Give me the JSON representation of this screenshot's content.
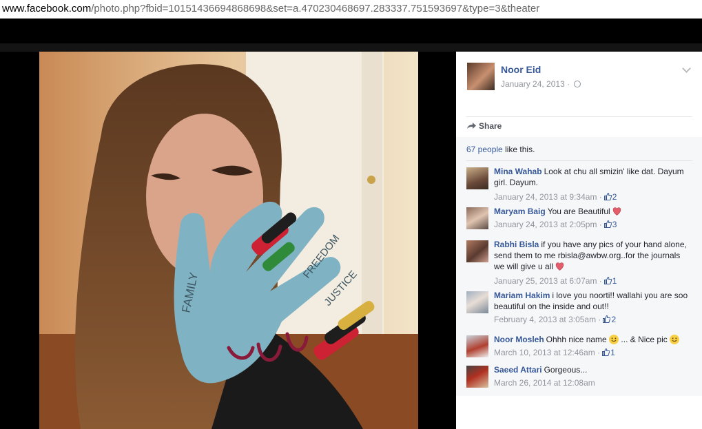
{
  "browser": {
    "url_domain": "www.facebook.com",
    "url_path": "/photo.php?fbid=10151436694868698&set=a.470230468697.283337.751593697&type=3&theater"
  },
  "photo": {
    "hand_words": [
      "FAMILY",
      "FREEDOM",
      "JUSTICE"
    ],
    "colors": {
      "hand": "#7fb3c4",
      "skin": "#d9a48a",
      "hair": "#6b4226"
    }
  },
  "post": {
    "owner_name": "Noor Eid",
    "date": "January 24, 2013",
    "separator": "·",
    "share_label": "Share"
  },
  "likes": {
    "count_link": "67 people",
    "suffix": "like this."
  },
  "comments": [
    {
      "name": "Mina Wahab",
      "text": "Look at chu all smizin' like dat. Dayum girl. Dayum.",
      "time": "January 24, 2013 at 9:34am",
      "likes": "2"
    },
    {
      "name": "Maryam Baig",
      "text": "You are Beautiful",
      "time": "January 24, 2013 at 2:05pm",
      "likes": "3"
    },
    {
      "name": "Rabhi Bisla",
      "text": "if you have any pics of your hand alone, send them to me rbisla@awbw.org..for the journals we will give u all",
      "time": "January 25, 2013 at 6:07am",
      "likes": "1"
    },
    {
      "name": "Mariam Hakim",
      "text": "i love you noorti!! wallahi you are soo beautiful on the inside and out!!",
      "time": "February 4, 2013 at 3:05am",
      "likes": "2"
    },
    {
      "name": "Noor Mosleh",
      "text_a": "Ohhh nice name",
      "text_b": "... & Nice pic",
      "time": "March 10, 2013 at 12:46am",
      "likes": "1"
    },
    {
      "name": "Saeed Attari",
      "text": "Gorgeous...",
      "time": "March 26, 2014 at 12:08am"
    }
  ]
}
